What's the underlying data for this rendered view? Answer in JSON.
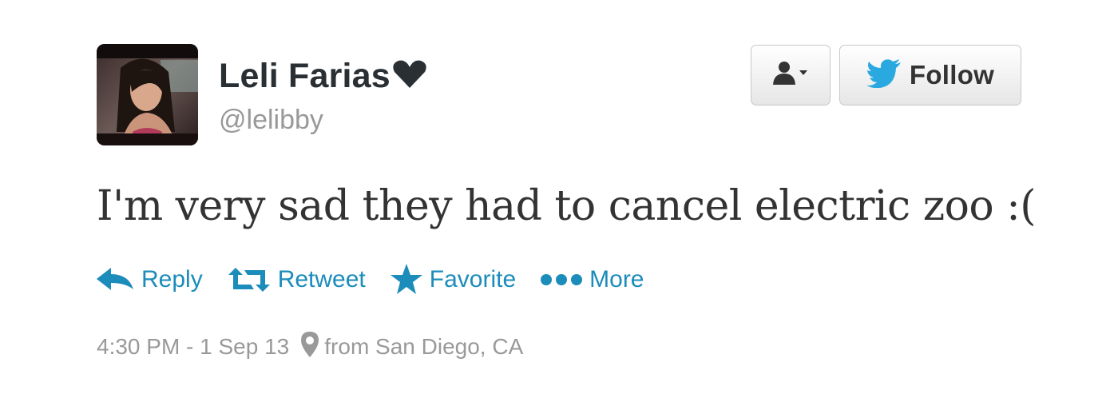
{
  "tweet": {
    "user": {
      "name": "Leli Farias",
      "screen_name": "@lelibby",
      "name_suffix_icon": "heart-icon",
      "avatar": "profile-photo"
    },
    "header_buttons": {
      "user_actions_icon": "person-dropdown-icon",
      "follow_label": "Follow",
      "follow_icon": "twitter-bird-icon"
    },
    "text": "I'm very sad they had to cancel electric zoo :(",
    "actions": [
      {
        "label": "Reply",
        "icon": "reply-arrow-icon"
      },
      {
        "label": "Retweet",
        "icon": "retweet-icon"
      },
      {
        "label": "Favorite",
        "icon": "star-icon"
      },
      {
        "label": "More",
        "icon": "dots-icon"
      }
    ],
    "meta": {
      "timestamp": "4:30 PM - 1 Sep 13",
      "location_icon": "map-pin-icon",
      "location": "from San Diego, CA"
    },
    "colors": {
      "link": "#1c8cba",
      "twitter_blue": "#2aa9e0",
      "muted": "#999999",
      "text": "#333333"
    }
  }
}
